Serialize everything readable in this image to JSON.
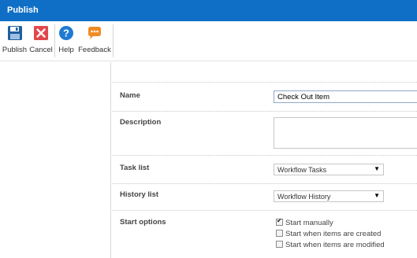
{
  "window": {
    "title": "Publish"
  },
  "ribbon": {
    "buttons": [
      {
        "id": "publish",
        "label": "Publish",
        "icon": "floppy-disk-icon",
        "color": "#1f5f9e"
      },
      {
        "id": "cancel",
        "label": "Cancel",
        "icon": "close-icon",
        "color": "#e0474c"
      },
      {
        "id": "help",
        "label": "Help",
        "icon": "question-circle-icon",
        "color": "#1f7ad1"
      },
      {
        "id": "feedback",
        "label": "Feedback",
        "icon": "speech-bubble-icon",
        "color": "#f08a24"
      }
    ]
  },
  "form": {
    "name": {
      "label": "Name",
      "value": "Check Out Item"
    },
    "description": {
      "label": "Description",
      "value": ""
    },
    "task_list": {
      "label": "Task list",
      "value": "Workflow Tasks"
    },
    "history_list": {
      "label": "History list",
      "value": "Workflow History"
    },
    "start_options": {
      "label": "Start options",
      "options": [
        {
          "label": "Start manually",
          "checked": true
        },
        {
          "label": "Start when items are created",
          "checked": false
        },
        {
          "label": "Start when items are modified",
          "checked": false
        }
      ]
    }
  },
  "colors": {
    "titlebar": "#0f6fc6",
    "border": "#d8d8d8"
  }
}
